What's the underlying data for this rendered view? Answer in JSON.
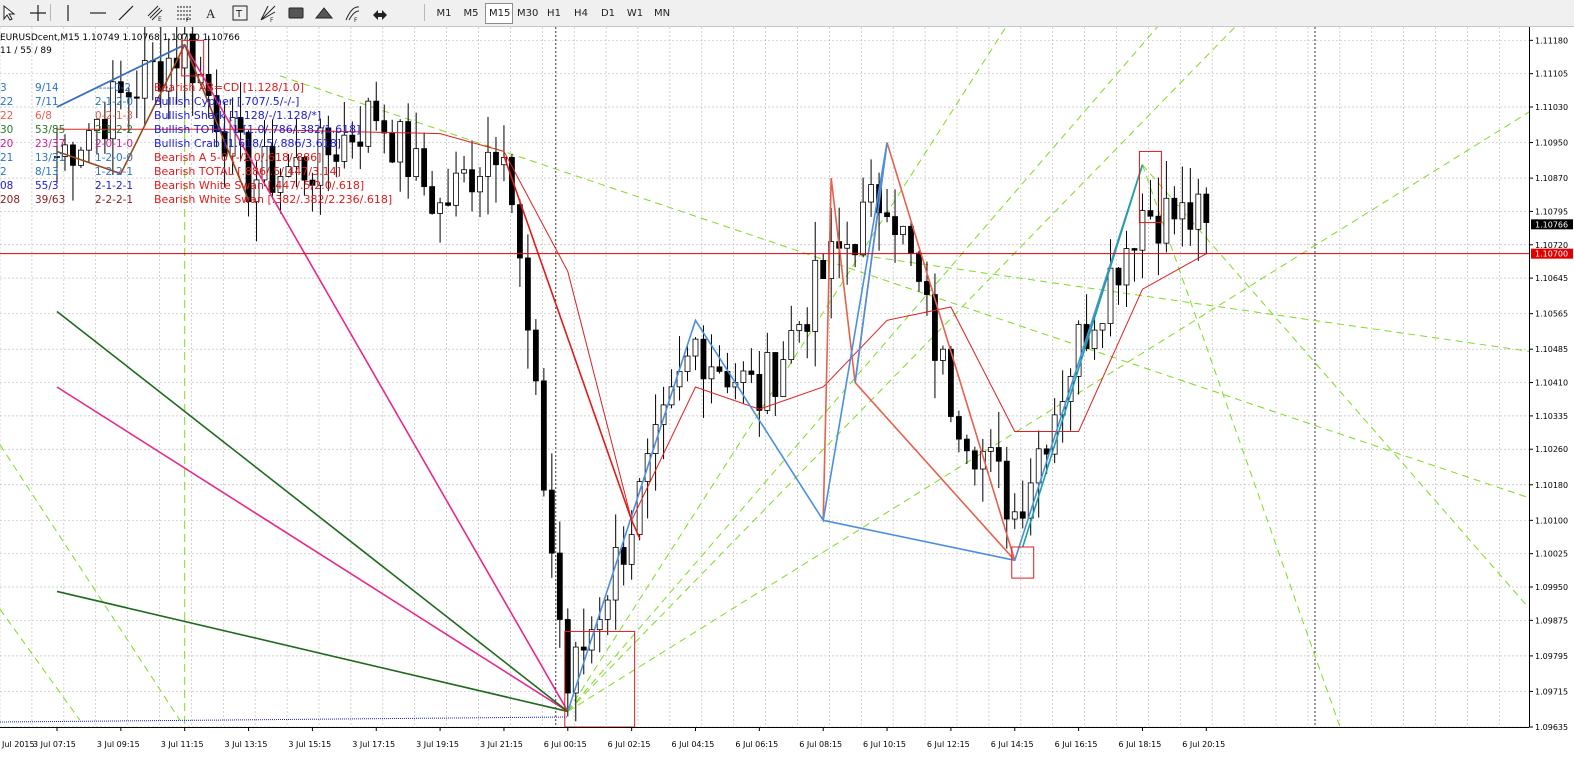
{
  "toolbar": {
    "timeframes": [
      {
        "label": "M1",
        "active": false
      },
      {
        "label": "M5",
        "active": false
      },
      {
        "label": "M15",
        "active": true
      },
      {
        "label": "M30",
        "active": false
      },
      {
        "label": "H1",
        "active": false
      },
      {
        "label": "H4",
        "active": false
      },
      {
        "label": "D1",
        "active": false
      },
      {
        "label": "W1",
        "active": false
      },
      {
        "label": "MN",
        "active": false
      }
    ],
    "tools": [
      "cursor-icon",
      "crosshair-icon",
      "vertical-line-icon",
      "horizontal-line-icon",
      "trendline-icon",
      "equidistant-channel-icon",
      "fibonacci-retracement-icon",
      "text-icon",
      "text-label-icon",
      "fibonacci-fan-icon",
      "rectangle-icon",
      "triangle-icon",
      "fibonacci-arcs-icon",
      "arrows-dropdown-icon"
    ]
  },
  "chart": {
    "header": "EURUSDcent,M15  1.10749 1.10768 1.10720 1.10766",
    "subheader": "11 / 55 / 89",
    "symbol": "EURUSDcent",
    "timeframe": "M15",
    "current_price_label": "1.10766",
    "red_line_label": "1.10700",
    "colors": {
      "bull": "#ffffff",
      "bear": "#000000",
      "outline": "#000000",
      "ma": "#e02020",
      "grid": "#c0c0c0",
      "price_line": "#e00000",
      "lime": "#7ddc1f"
    }
  },
  "patterns_table": [
    {
      "c1": "3",
      "c2": "9/14",
      "c3": "-----0-2",
      "name": "Bearish AB=CD [1.128/1.0]",
      "color": "#e01b1b",
      "c1color": "#2c74c8"
    },
    {
      "c1": "22",
      "c2": "7/11",
      "c3": "2-1-2-0",
      "name": "Bullish Cypher [.707/.5/-/-]",
      "color": "#1b1bd8",
      "c1color": "#2c74c8"
    },
    {
      "c1": "22",
      "c2": "6/8",
      "c3": "0-2-1-3",
      "name": "Bullish Shark [1.128/-/1.128/*]",
      "color": "#1b1bd8",
      "c1color": "#e8604c"
    },
    {
      "c1": "30",
      "c2": "53/85",
      "c3": "2-1-2-2",
      "name": "Bullish TOTAL 1 [1.0/.786/.382/1.618]",
      "color": "#1b1bd8",
      "c1color": "#2a7a2a"
    },
    {
      "c1": "20",
      "c2": "23/37",
      "c3": "2-0-1-0",
      "name": "Bullish Crab [1.618/.5/.886/3.618]",
      "color": "#1b1bd8",
      "c1color": "#d81b8c"
    },
    {
      "c1": "21",
      "c2": "13/21",
      "c3": "1-2-0-0",
      "name": "Bearish A 5-0 [-/2.0/.618/.886]",
      "color": "#e01b1b",
      "c1color": "#2c74c8"
    },
    {
      "c1": "2",
      "c2": "8/13",
      "c3": "1-2-2-1",
      "name": "Bearish TOTAL [.886/.5/.447/3.14]",
      "color": "#e01b1b",
      "c1color": "#2c74c8"
    },
    {
      "c1": "08",
      "c2": "55/3",
      "c3": "2-1-2-1",
      "name": "Bearish White Swan [.447/.5/2.0/.618]",
      "color": "#e01b1b",
      "c1color": "#1b1bd8"
    },
    {
      "c1": "208",
      "c2": "39/63",
      "c3": "2-2-2-1",
      "name": "Bearish White Swan [.382/.382/2.236/.618]",
      "color": "#e01b1b",
      "c1color": "#8a1b1b"
    }
  ],
  "chart_data": {
    "type": "candlestick",
    "x_axis_labels": [
      "3 Jul 07:15",
      "3 Jul 09:15",
      "3 Jul 11:15",
      "3 Jul 13:15",
      "3 Jul 15:15",
      "3 Jul 17:15",
      "3 Jul 19:15",
      "3 Jul 21:15",
      "6 Jul 00:15",
      "6 Jul 02:15",
      "6 Jul 04:15",
      "6 Jul 06:15",
      "6 Jul 08:15",
      "6 Jul 10:15",
      "6 Jul 12:15",
      "6 Jul 14:15",
      "6 Jul 16:15",
      "6 Jul 18:15",
      "6 Jul 20:15"
    ],
    "first_x_label": "Jul 2015",
    "y_axis_labels": [
      "1.11180",
      "1.11105",
      "1.11030",
      "1.10950",
      "1.10870",
      "1.10795",
      "1.10720",
      "1.10645",
      "1.10565",
      "1.10485",
      "1.10410",
      "1.10335",
      "1.10260",
      "1.10180",
      "1.10100",
      "1.10025",
      "1.09950",
      "1.09875",
      "1.09795",
      "1.09715",
      "1.09635"
    ],
    "y_range": [
      1.09635,
      1.1121
    ],
    "anchors": [
      {
        "label": "3 Jul 07:15",
        "price": 1.1092
      },
      {
        "label": "3 Jul 09:15",
        "price": 1.1105
      },
      {
        "label": "3 Jul 11:15",
        "price": 1.1117
      },
      {
        "label": "3 Jul 13:15",
        "price": 1.1087
      },
      {
        "label": "3 Jul 15:15",
        "price": 1.109
      },
      {
        "label": "3 Jul 17:15",
        "price": 1.1102
      },
      {
        "label": "3 Jul 19:15",
        "price": 1.108
      },
      {
        "label": "3 Jul 21:15",
        "price": 1.1098
      },
      {
        "label": "6 Jul 00:15",
        "price": 1.0972
      },
      {
        "label": "6 Jul 02:15",
        "price": 1.101
      },
      {
        "label": "6 Jul 04:15",
        "price": 1.105
      },
      {
        "label": "6 Jul 06:15",
        "price": 1.1038
      },
      {
        "label": "6 Jul 08:15",
        "price": 1.1065
      },
      {
        "label": "6 Jul 10:15",
        "price": 1.1085
      },
      {
        "label": "6 Jul 12:15",
        "price": 1.1038
      },
      {
        "label": "6 Jul 14:15",
        "price": 1.1012
      },
      {
        "label": "6 Jul 16:15",
        "price": 1.105
      },
      {
        "label": "6 Jul 18:15",
        "price": 1.108
      },
      {
        "label": "6 Jul 20:15",
        "price": 1.1077
      }
    ],
    "ma_anchors": [
      {
        "label": "3 Jul 07:15",
        "price": 1.1098
      },
      {
        "label": "3 Jul 13:15",
        "price": 1.1098
      },
      {
        "label": "3 Jul 19:15",
        "price": 1.1097
      },
      {
        "label": "3 Jul 21:15",
        "price": 1.1093
      },
      {
        "label": "6 Jul 00:15",
        "price": 1.1066
      },
      {
        "label": "6 Jul 02:15",
        "price": 1.101
      },
      {
        "label": "6 Jul 04:15",
        "price": 1.104
      },
      {
        "label": "6 Jul 06:15",
        "price": 1.1035
      },
      {
        "label": "6 Jul 08:15",
        "price": 1.104
      },
      {
        "label": "6 Jul 10:15",
        "price": 1.1055
      },
      {
        "label": "6 Jul 12:15",
        "price": 1.1058
      },
      {
        "label": "6 Jul 14:15",
        "price": 1.103
      },
      {
        "label": "6 Jul 16:15",
        "price": 1.103
      },
      {
        "label": "6 Jul 18:15",
        "price": 1.1062
      },
      {
        "label": "6 Jul 20:15",
        "price": 1.107
      }
    ],
    "harmonic_lines": [
      {
        "color": "#e8604c",
        "points": [
          [
            "6 Jul 08:15",
            1.101
          ],
          [
            "6 Jul 08:30",
            1.1087
          ],
          [
            "6 Jul 09:15",
            1.1041
          ],
          [
            "6 Jul 10:15",
            1.1095
          ],
          [
            "6 Jul 14:15",
            1.1001
          ]
        ]
      },
      {
        "color": "#e8604c",
        "points": [
          [
            "6 Jul 09:15",
            1.1041
          ],
          [
            "6 Jul 14:15",
            1.1001
          ]
        ]
      },
      {
        "color": "#4b8fe0",
        "points": [
          [
            "6 Jul 00:15",
            1.0967
          ],
          [
            "6 Jul 04:15",
            1.1055
          ],
          [
            "6 Jul 08:15",
            1.101
          ],
          [
            "6 Jul 10:15",
            1.1095
          ],
          [
            "6 Jul 09:15",
            1.1041
          ]
        ]
      },
      {
        "color": "#4b8fe0",
        "points": [
          [
            "6 Jul 08:15",
            1.101
          ],
          [
            "6 Jul 14:15",
            1.1001
          ],
          [
            "6 Jul 18:15",
            1.109
          ]
        ]
      },
      {
        "color": "#1e9fa0",
        "points": [
          [
            "6 Jul 14:30",
            1.1004
          ],
          [
            "6 Jul 18:15",
            1.109
          ]
        ]
      },
      {
        "color": "#e8298c",
        "points": [
          [
            "3 Jul 11:15",
            1.1117
          ],
          [
            "6 Jul 00:15",
            1.0967
          ]
        ]
      },
      {
        "color": "#e8298c",
        "points": [
          [
            "3 Jul 07:15",
            1.104
          ],
          [
            "6 Jul 00:15",
            1.0967
          ]
        ]
      },
      {
        "color": "#1d6a1d",
        "points": [
          [
            "3 Jul 07:15",
            1.1057
          ],
          [
            "6 Jul 00:15",
            1.0967
          ]
        ]
      },
      {
        "color": "#1d6a1d",
        "points": [
          [
            "3 Jul 07:15",
            1.0994
          ],
          [
            "6 Jul 00:15",
            1.0967
          ]
        ]
      },
      {
        "color": "#e01b1b",
        "points": [
          [
            "3 Jul 21:15",
            1.1092
          ],
          [
            "6 Jul 02:15",
            1.101
          ],
          [
            "6 Jul 02:30",
            1.1006
          ]
        ]
      },
      {
        "color": "#9a4a1a",
        "points": [
          [
            "3 Jul 07:15",
            1.1103
          ],
          [
            "3 Jul 11:15",
            1.1117
          ],
          [
            "3 Jul 13:15",
            1.1082
          ]
        ]
      },
      {
        "color": "#9a4a1a",
        "points": [
          [
            "3 Jul 07:15",
            1.1093
          ],
          [
            "3 Jul 09:15",
            1.1088
          ],
          [
            "3 Jul 11:15",
            1.1117
          ]
        ]
      },
      {
        "color": "#2c74c8",
        "points": [
          [
            "3 Jul 07:15",
            1.1103
          ],
          [
            "3 Jul 11:15",
            1.1117
          ]
        ]
      }
    ],
    "boxes": [
      {
        "color": "#e01b1b",
        "t1": "6 Jul 00:15",
        "t2": "6 Jul 02:15",
        "p1": 1.0985,
        "p2": 1.09635
      },
      {
        "color": "#e01b1b",
        "t1": "6 Jul 14:15",
        "t2": "6 Jul 14:45",
        "p1": 1.1004,
        "p2": 1.0997
      },
      {
        "color": "#e01b1b",
        "t1": "6 Jul 18:15",
        "t2": "6 Jul 18:45",
        "p1": 1.1093,
        "p2": 1.1077
      },
      {
        "color": "#e01b1b",
        "t1": "3 Jul 11:15",
        "t2": "3 Jul 11:45",
        "p1": 1.1118,
        "p2": 1.111
      }
    ]
  }
}
